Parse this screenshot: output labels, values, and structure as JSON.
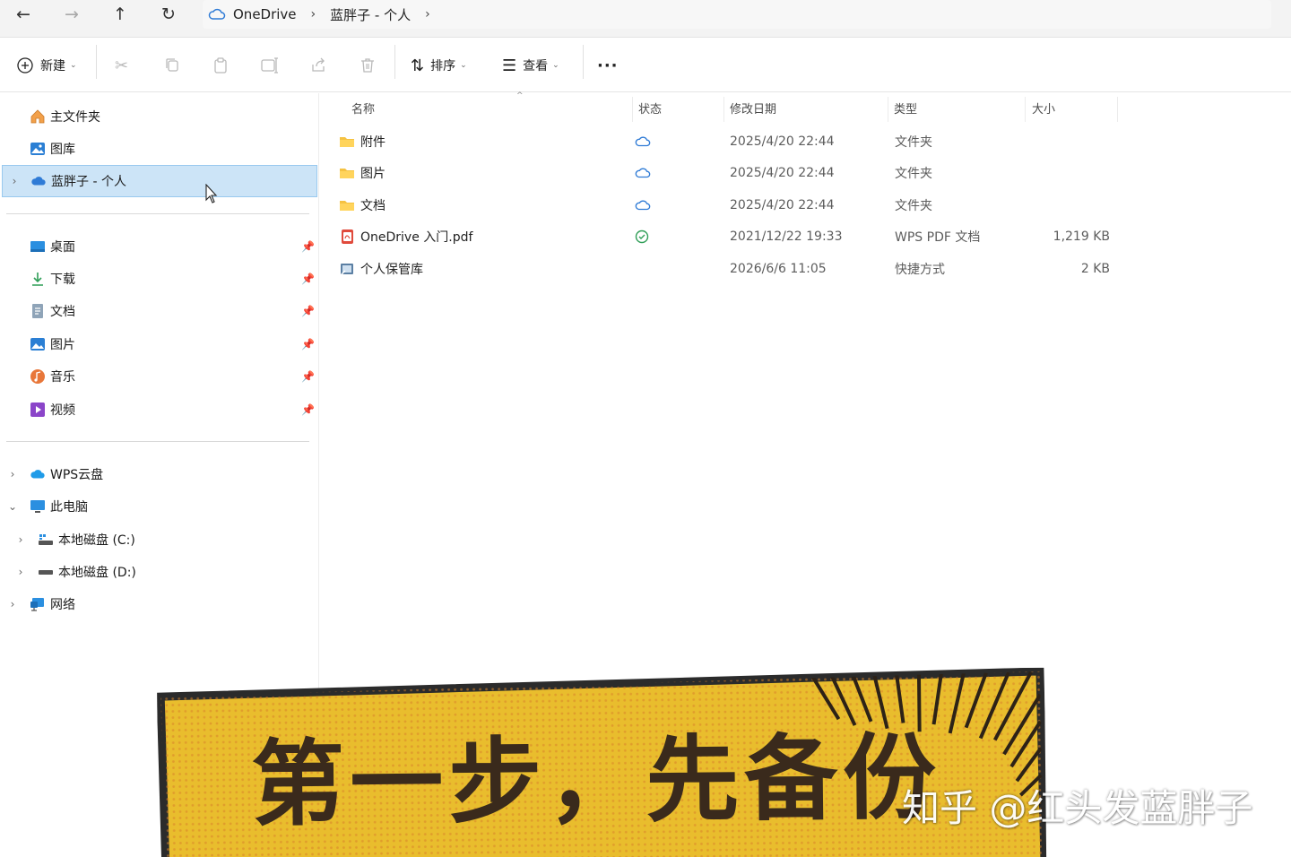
{
  "address": {
    "back": "←",
    "forward": "→",
    "up": "↑",
    "refresh": "↻",
    "breadcrumb": [
      "OneDrive",
      "蓝胖子 - 个人"
    ]
  },
  "toolbar": {
    "new_label": "新建",
    "sort_label": "排序",
    "view_label": "查看",
    "more_label": "···"
  },
  "sidebar": {
    "top": [
      {
        "label": "主文件夹",
        "icon": "home-icon"
      },
      {
        "label": "图库",
        "icon": "gallery-icon"
      },
      {
        "label": "蓝胖子 - 个人",
        "icon": "onedrive-cloud-icon",
        "selected": true
      }
    ],
    "quick": [
      {
        "label": "桌面",
        "icon": "desktop-icon"
      },
      {
        "label": "下载",
        "icon": "download-icon"
      },
      {
        "label": "文档",
        "icon": "documents-icon"
      },
      {
        "label": "图片",
        "icon": "pictures-icon"
      },
      {
        "label": "音乐",
        "icon": "music-icon"
      },
      {
        "label": "视频",
        "icon": "videos-icon"
      }
    ],
    "tree": [
      {
        "label": "WPS云盘",
        "icon": "wps-cloud-icon"
      },
      {
        "label": "此电脑",
        "icon": "this-pc-icon"
      },
      {
        "label": "本地磁盘 (C:)",
        "icon": "drive-c-icon"
      },
      {
        "label": "本地磁盘 (D:)",
        "icon": "drive-d-icon"
      },
      {
        "label": "网络",
        "icon": "network-icon"
      }
    ]
  },
  "columns": [
    "名称",
    "状态",
    "修改日期",
    "类型",
    "大小"
  ],
  "files": [
    {
      "name": "附件",
      "status": "cloud",
      "date": "2025/4/20 22:44",
      "type": "文件夹",
      "size": ""
    },
    {
      "name": "图片",
      "status": "cloud",
      "date": "2025/4/20 22:44",
      "type": "文件夹",
      "size": ""
    },
    {
      "name": "文档",
      "status": "cloud",
      "date": "2025/4/20 22:44",
      "type": "文件夹",
      "size": ""
    },
    {
      "name": "OneDrive 入门.pdf",
      "status": "synced",
      "date": "2021/12/22 19:33",
      "type": "WPS PDF 文档",
      "size": "1,219 KB"
    },
    {
      "name": "个人保管库",
      "status": "",
      "date": "2026/6/6 11:05",
      "type": "快捷方式",
      "size": "2 KB"
    }
  ],
  "overlay": {
    "banner_text": "第一步，先备份",
    "watermark": "知乎 @红头发蓝胖子"
  },
  "colors": {
    "selection_bg": "#cce4f7",
    "folder_yellow": "#f5c242",
    "cloud_blue": "#2f7bd6",
    "synced_green": "#2f9e57",
    "banner_yellow": "#e6b92a"
  }
}
